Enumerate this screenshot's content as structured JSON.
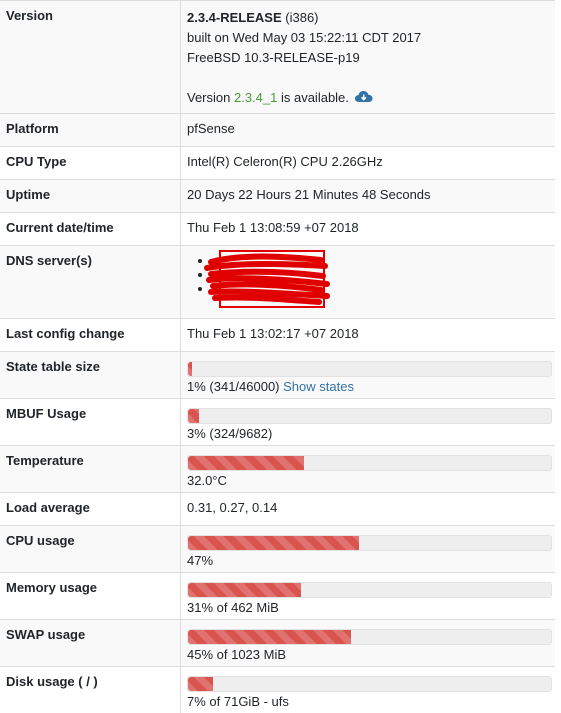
{
  "version": {
    "label": "Version",
    "release": "2.3.4-RELEASE",
    "arch": " (i386)",
    "built_on": "built on Wed May 03 15:22:11 CDT 2017",
    "base": "FreeBSD 10.3-RELEASE-p19",
    "update_prefix": "Version ",
    "update_version": "2.3.4_1",
    "update_suffix": " is available.",
    "update_icon": "cloud-download-icon"
  },
  "platform": {
    "label": "Platform",
    "value": "pfSense"
  },
  "cpu_type": {
    "label": "CPU Type",
    "value": "Intel(R) Celeron(R) CPU 2.26GHz"
  },
  "uptime": {
    "label": "Uptime",
    "value": "20 Days 22 Hours 21 Minutes 48 Seconds"
  },
  "datetime": {
    "label": "Current date/time",
    "value": "Thu Feb 1 13:08:59 +07 2018"
  },
  "dns": {
    "label": "DNS server(s)",
    "redacted": true,
    "bullet_count": 3
  },
  "last_config": {
    "label": "Last config change",
    "value": "Thu Feb 1 13:02:17 +07 2018"
  },
  "state_table": {
    "label": "State table size",
    "percent": 1,
    "text": "1% (341/46000) ",
    "link": "Show states"
  },
  "mbuf": {
    "label": "MBUF Usage",
    "percent": 3,
    "text": "3% (324/9682)"
  },
  "temperature": {
    "label": "Temperature",
    "percent": 32,
    "text": "32.0°C"
  },
  "load_average": {
    "label": "Load average",
    "value": "0.31, 0.27, 0.14"
  },
  "cpu_usage": {
    "label": "CPU usage",
    "percent": 47,
    "text": "47%"
  },
  "memory": {
    "label": "Memory usage",
    "percent": 31,
    "text": "31% of 462 MiB"
  },
  "swap": {
    "label": "SWAP usage",
    "percent": 45,
    "text": "45% of 1023 MiB"
  },
  "disk": {
    "label": "Disk usage ( / )",
    "percent": 7,
    "text": "7% of 71GiB - ufs"
  },
  "colors": {
    "bar_fill": "#d9534f",
    "link": "#3173a5",
    "update_version": "#4b9a37",
    "redaction": "#e00000"
  }
}
